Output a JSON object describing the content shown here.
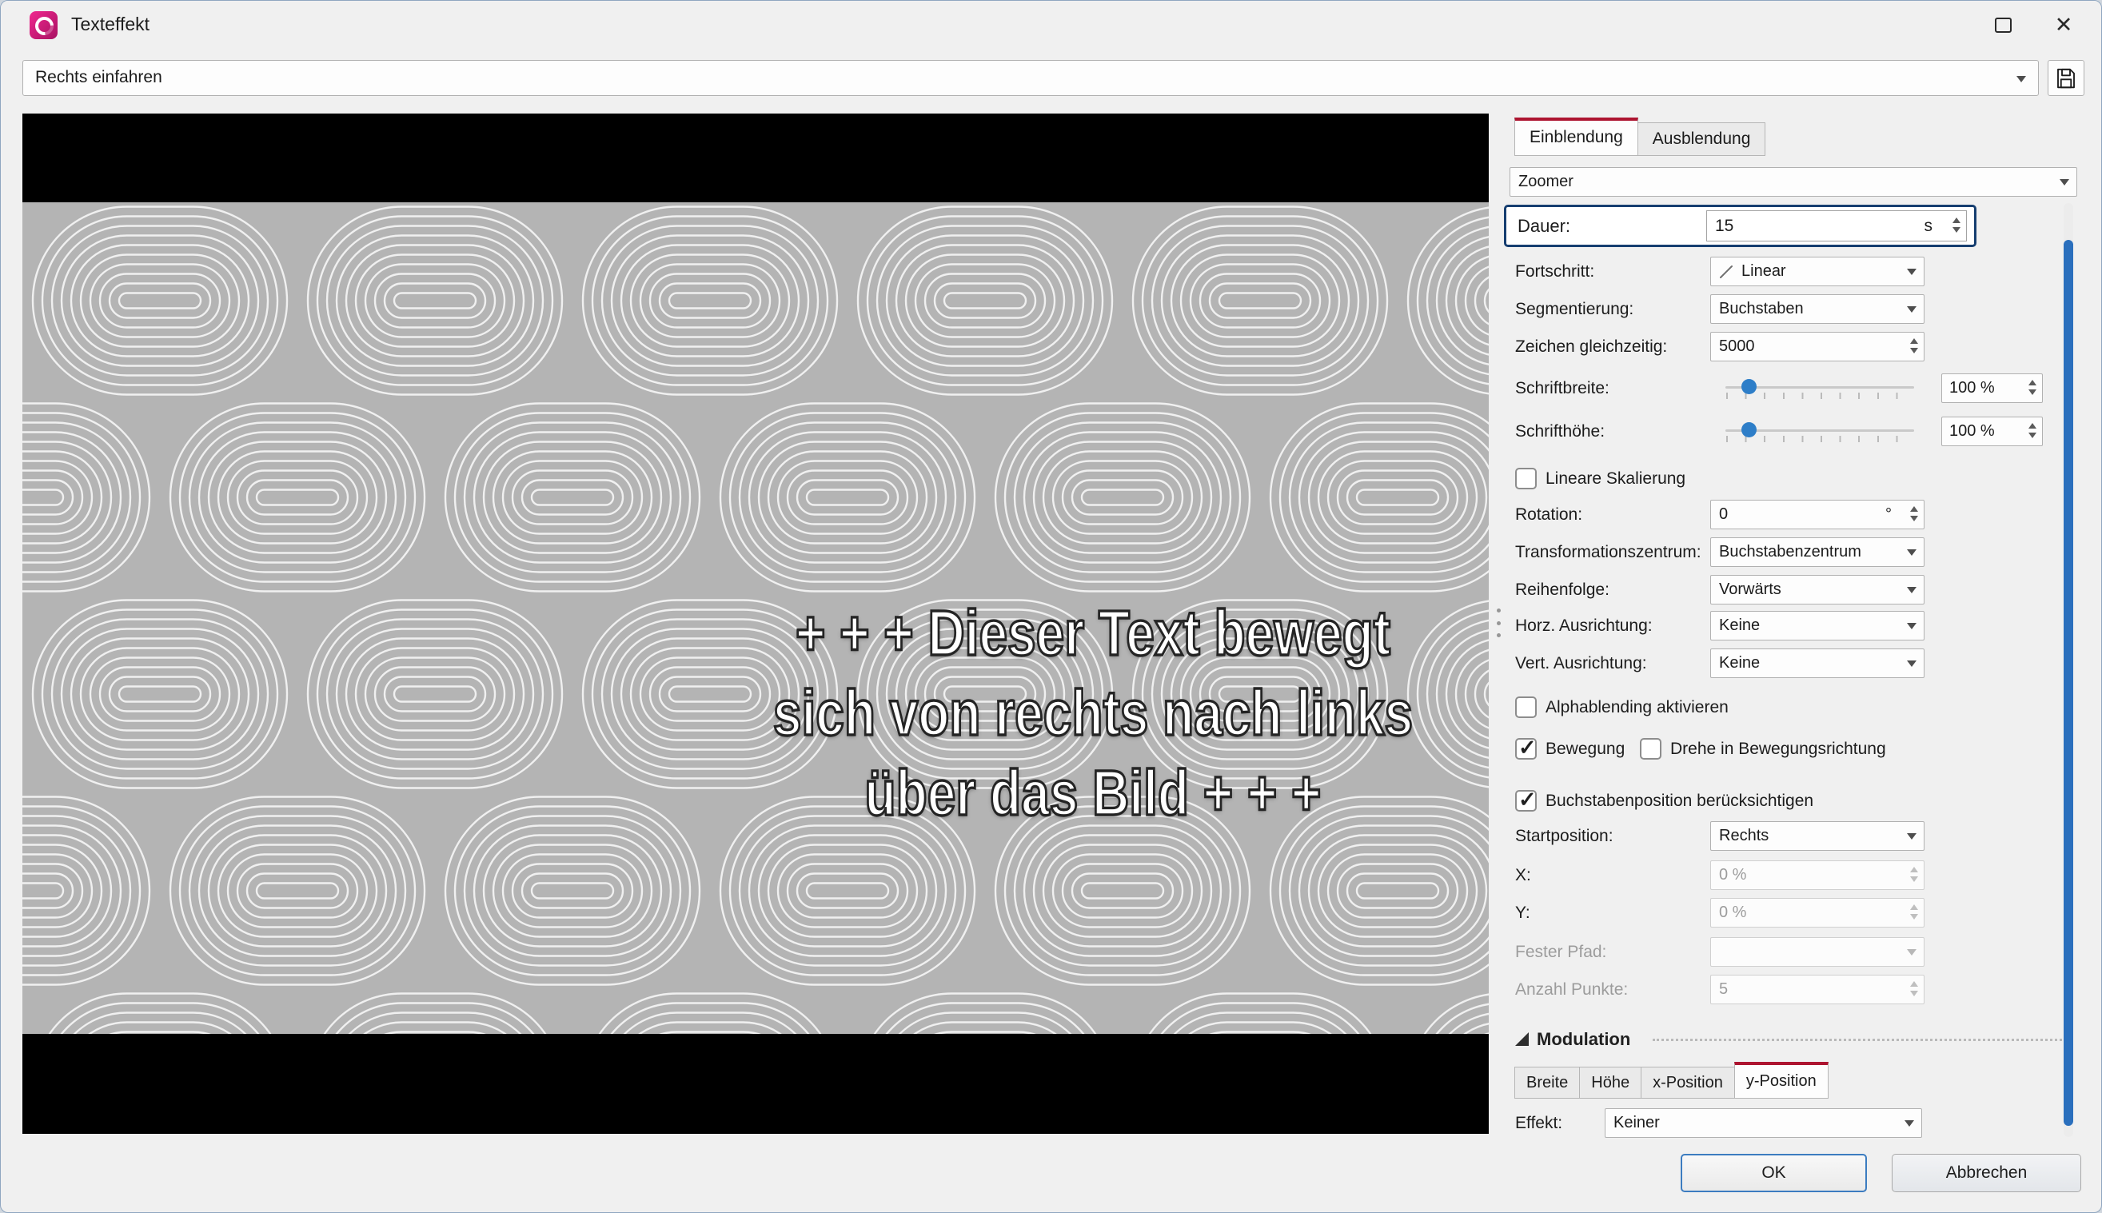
{
  "window": {
    "title": "Texteffekt"
  },
  "preset": {
    "value": "Rechts einfahren"
  },
  "preview": {
    "lines": [
      "+ + + Dieser Text bewegt",
      "sich von rechts nach links",
      "über das Bild + + +"
    ]
  },
  "tabs": {
    "einblendung": "Einblendung",
    "ausblendung": "Ausblendung"
  },
  "fields": {
    "effect": {
      "value": "Zoomer"
    },
    "dauer": {
      "label": "Dauer:",
      "value": "15",
      "unit": "s"
    },
    "fortschritt": {
      "label": "Fortschritt:",
      "value": "Linear"
    },
    "segmentierung": {
      "label": "Segmentierung:",
      "value": "Buchstaben"
    },
    "zeichen": {
      "label": "Zeichen gleichzeitig:",
      "value": "5000"
    },
    "schriftbreite": {
      "label": "Schriftbreite:",
      "value": "100 %"
    },
    "schrifthoehe": {
      "label": "Schrifthöhe:",
      "value": "100 %"
    },
    "lineare_skalierung": {
      "label": "Lineare Skalierung",
      "checked": false
    },
    "rotation": {
      "label": "Rotation:",
      "value": "0",
      "unit": "°"
    },
    "transformationszentrum": {
      "label": "Transformationszentrum:",
      "value": "Buchstabenzentrum"
    },
    "reihenfolge": {
      "label": "Reihenfolge:",
      "value": "Vorwärts"
    },
    "horz_ausrichtung": {
      "label": "Horz. Ausrichtung:",
      "value": "Keine"
    },
    "vert_ausrichtung": {
      "label": "Vert. Ausrichtung:",
      "value": "Keine"
    },
    "alphablending": {
      "label": "Alphablending aktivieren",
      "checked": false
    },
    "bewegung": {
      "label": "Bewegung",
      "checked": true
    },
    "drehe": {
      "label": "Drehe in Bewegungsrichtung",
      "checked": false
    },
    "buchstabenposition": {
      "label": "Buchstabenposition berücksichtigen",
      "checked": true
    },
    "startposition": {
      "label": "Startposition:",
      "value": "Rechts"
    },
    "x": {
      "label": "X:",
      "value": "0 %"
    },
    "y": {
      "label": "Y:",
      "value": "0 %"
    },
    "fester_pfad": {
      "label": "Fester Pfad:",
      "value": ""
    },
    "anzahl_punkte": {
      "label": "Anzahl Punkte:",
      "value": "5"
    }
  },
  "modulation": {
    "title": "Modulation",
    "tabs": [
      "Breite",
      "Höhe",
      "x-Position",
      "y-Position"
    ],
    "active_tab": "y-Position",
    "effekt": {
      "label": "Effekt:",
      "value": "Keiner"
    }
  },
  "buttons": {
    "ok": "OK",
    "cancel": "Abbrechen"
  }
}
